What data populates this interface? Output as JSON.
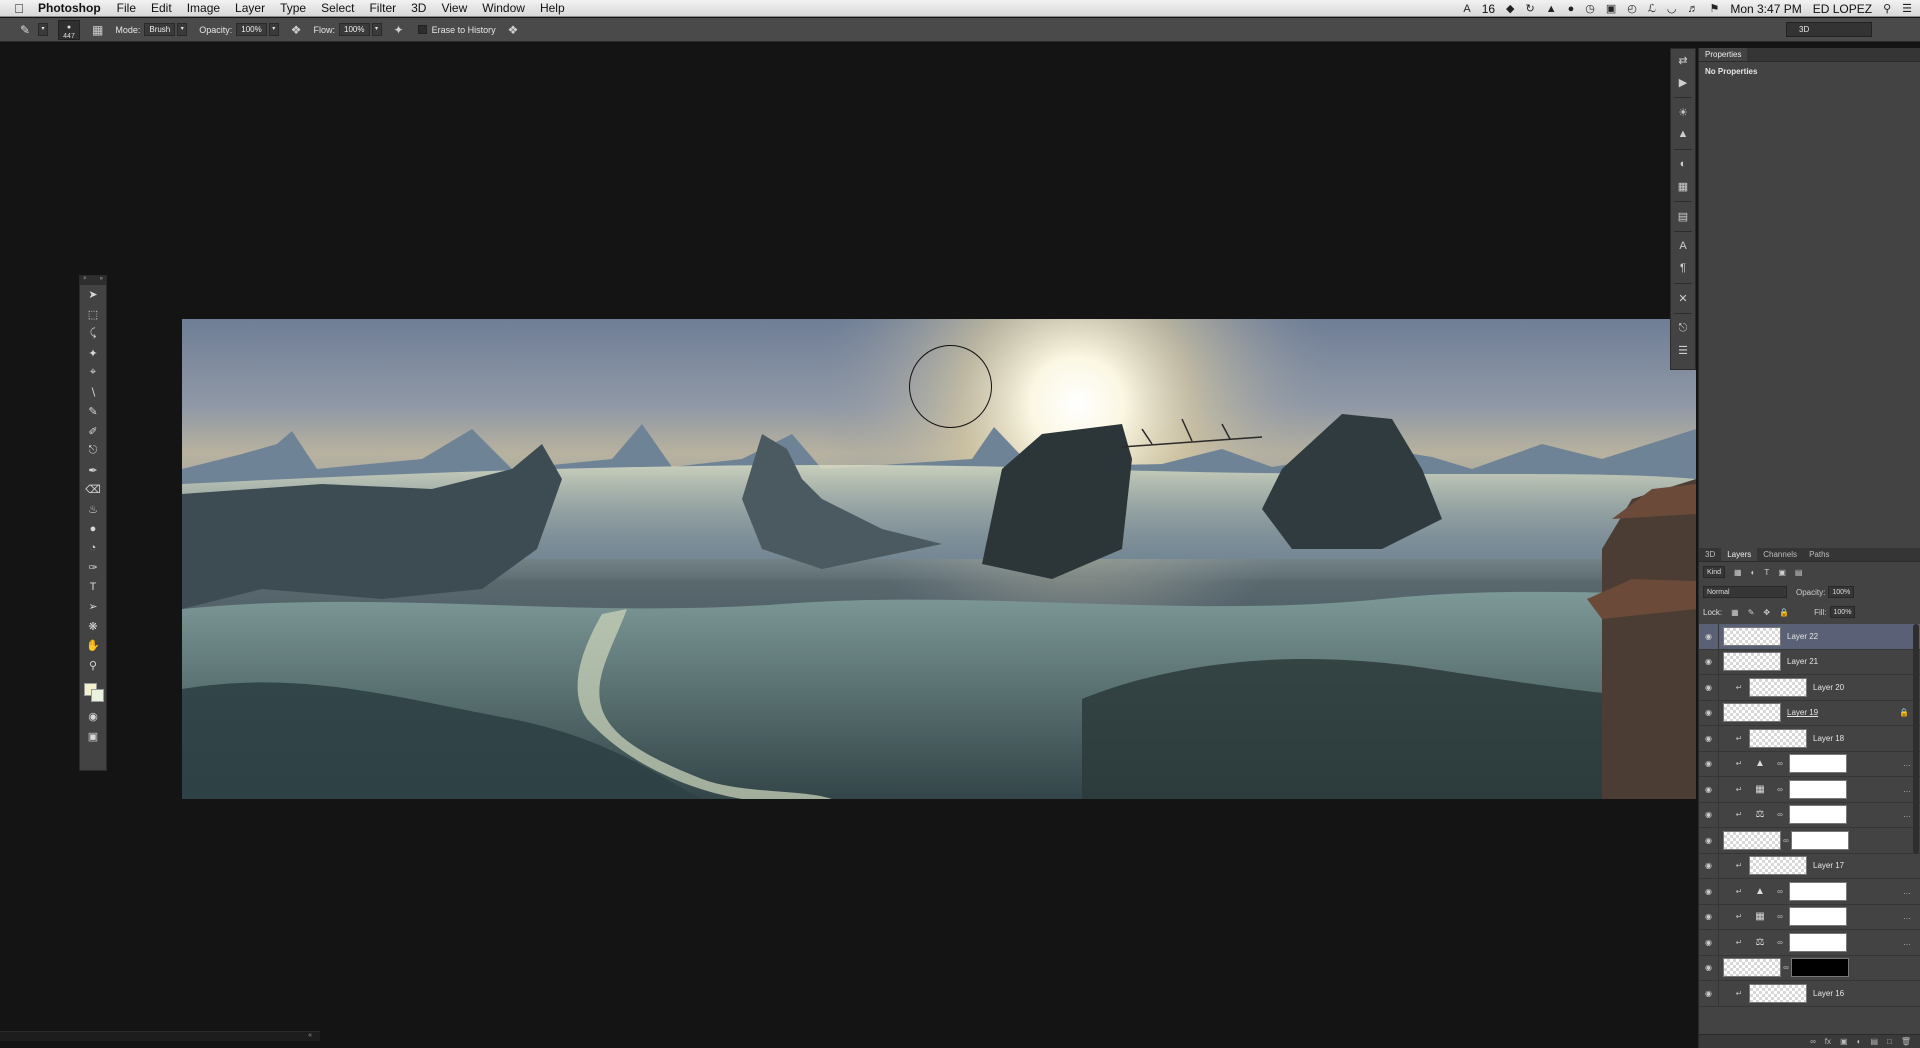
{
  "menubar": {
    "app": "Photoshop",
    "items": [
      "File",
      "Edit",
      "Image",
      "Layer",
      "Type",
      "Select",
      "Filter",
      "3D",
      "View",
      "Window",
      "Help"
    ],
    "status_count": "16",
    "clock": "Mon 3:47 PM",
    "user": "ED LOPEZ"
  },
  "options": {
    "brush_size": "447",
    "mode_label": "Mode:",
    "mode_value": "Brush",
    "opacity_label": "Opacity:",
    "opacity_value": "100%",
    "flow_label": "Flow:",
    "flow_value": "100%",
    "erase_history_label": "Erase to History",
    "workspace": "3D"
  },
  "properties": {
    "tab": "Properties",
    "message": "No Properties"
  },
  "layers_panel": {
    "tabs": [
      "3D",
      "Layers",
      "Channels",
      "Paths"
    ],
    "filter_value": "Kind",
    "blend_mode": "Normal",
    "opacity_label": "Opacity:",
    "opacity_value": "100%",
    "lock_label": "Lock:",
    "fill_label": "Fill:",
    "fill_value": "100%",
    "layers": [
      {
        "name": "Layer 22"
      },
      {
        "name": "Layer 21"
      },
      {
        "name": "Layer 20"
      },
      {
        "name": "Layer 19"
      },
      {
        "name": "Layer 18"
      },
      {
        "name": "Layer 17"
      },
      {
        "name": "Layer 16"
      }
    ]
  },
  "colors": {
    "foreground": "#f3f0cf",
    "background": "#e9f2df",
    "selected_layer": "#5a6076"
  }
}
